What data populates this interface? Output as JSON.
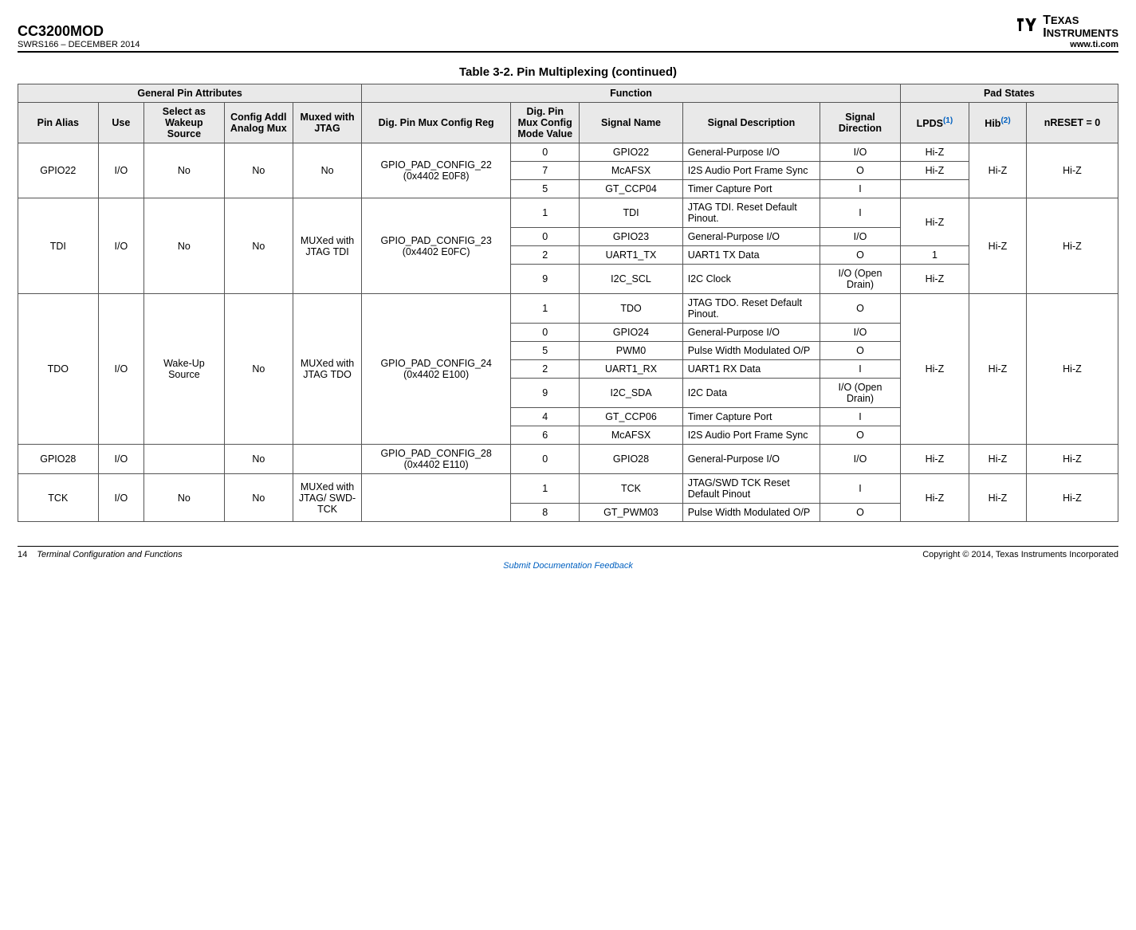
{
  "header": {
    "product": "CC3200MOD",
    "doc": "SWRS166 – DECEMBER 2014",
    "logo_text": "TEXAS INSTRUMENTS",
    "url": "www.ti.com"
  },
  "table": {
    "title": "Table 3-2. Pin Multiplexing (continued)",
    "group_headers": {
      "g1": "General Pin Attributes",
      "g2": "Function",
      "g3": "Pad States"
    },
    "col_headers": {
      "h1": "Pin Alias",
      "h2": "Use",
      "h3": "Select as Wakeup Source",
      "h4": "Config Addl Analog Mux",
      "h5": "Muxed with JTAG",
      "h6": "Dig. Pin Mux Config Reg",
      "h7": "Dig. Pin Mux Config Mode Value",
      "h8": "Signal Name",
      "h9": "Signal Description",
      "h10": "Signal Direction",
      "h11a": "LPDS",
      "h11ref": "(1)",
      "h12a": "Hib",
      "h12ref": "(2)",
      "h13": "nRESET = 0"
    },
    "rows": [
      {
        "alias": "GPIO22",
        "use": "I/O",
        "wakeup": "No",
        "analog": "No",
        "jtag": "No",
        "reg": "GPIO_PAD_CONFIG_22 (0x4402 E0F8)",
        "hib": "Hi-Z",
        "nreset": "Hi-Z",
        "funcs": [
          {
            "mode": "0",
            "name": "GPIO22",
            "desc": "General-Purpose I/O",
            "dir": "I/O",
            "lpds": "Hi-Z"
          },
          {
            "mode": "7",
            "name": "McAFSX",
            "desc": "I2S Audio Port Frame Sync",
            "dir": "O",
            "lpds": "Hi-Z"
          },
          {
            "mode": "5",
            "name": "GT_CCP04",
            "desc": "Timer Capture Port",
            "dir": "I",
            "lpds": ""
          }
        ]
      },
      {
        "alias": "TDI",
        "use": "I/O",
        "wakeup": "No",
        "analog": "No",
        "jtag": "MUXed with JTAG TDI",
        "reg": "GPIO_PAD_CONFIG_23 (0x4402 E0FC)",
        "hib": "Hi-Z",
        "nreset": "Hi-Z",
        "lpds_groups": [
          {
            "span": 2,
            "val": "Hi-Z"
          },
          {
            "span": 1,
            "val": "1"
          },
          {
            "span": 1,
            "val": "Hi-Z"
          }
        ],
        "funcs": [
          {
            "mode": "1",
            "name": "TDI",
            "desc": "JTAG TDI. Reset Default Pinout.",
            "dir": "I"
          },
          {
            "mode": "0",
            "name": "GPIO23",
            "desc": "General-Purpose I/O",
            "dir": "I/O"
          },
          {
            "mode": "2",
            "name": "UART1_TX",
            "desc": "UART1 TX Data",
            "dir": "O"
          },
          {
            "mode": "9",
            "name": "I2C_SCL",
            "desc": "I2C Clock",
            "dir": "I/O (Open Drain)"
          }
        ]
      },
      {
        "alias": "TDO",
        "use": "I/O",
        "wakeup": "Wake-Up Source",
        "analog": "No",
        "jtag": "MUXed with JTAG TDO",
        "reg": "GPIO_PAD_CONFIG_24 (0x4402 E100)",
        "lpds": "Hi-Z",
        "hib": "Hi-Z",
        "nreset": "Hi-Z",
        "funcs": [
          {
            "mode": "1",
            "name": "TDO",
            "desc": "JTAG TDO. Reset Default Pinout.",
            "dir": "O"
          },
          {
            "mode": "0",
            "name": "GPIO24",
            "desc": "General-Purpose I/O",
            "dir": "I/O"
          },
          {
            "mode": "5",
            "name": "PWM0",
            "desc": "Pulse Width Modulated O/P",
            "dir": "O"
          },
          {
            "mode": "2",
            "name": "UART1_RX",
            "desc": "UART1 RX Data",
            "dir": "I"
          },
          {
            "mode": "9",
            "name": "I2C_SDA",
            "desc": "I2C Data",
            "dir": "I/O (Open Drain)"
          },
          {
            "mode": "4",
            "name": "GT_CCP06",
            "desc": "Timer Capture Port",
            "dir": "I"
          },
          {
            "mode": "6",
            "name": "McAFSX",
            "desc": "I2S Audio Port Frame Sync",
            "dir": "O"
          }
        ]
      },
      {
        "alias": "GPIO28",
        "use": "I/O",
        "wakeup": "",
        "analog": "No",
        "jtag": "",
        "reg": "GPIO_PAD_CONFIG_28 (0x4402 E110)",
        "lpds": "Hi-Z",
        "hib": "Hi-Z",
        "nreset": "Hi-Z",
        "funcs": [
          {
            "mode": "0",
            "name": "GPIO28",
            "desc": "General-Purpose I/O",
            "dir": "I/O"
          }
        ]
      },
      {
        "alias": "TCK",
        "use": "I/O",
        "wakeup": "No",
        "analog": "No",
        "jtag": "MUXed with JTAG/ SWD-TCK",
        "reg": "",
        "lpds": "Hi-Z",
        "hib": "Hi-Z",
        "nreset": "Hi-Z",
        "funcs": [
          {
            "mode": "1",
            "name": "TCK",
            "desc": "JTAG/SWD TCK Reset Default Pinout",
            "dir": "I"
          },
          {
            "mode": "8",
            "name": "GT_PWM03",
            "desc": "Pulse Width Modulated O/P",
            "dir": "O"
          }
        ]
      }
    ]
  },
  "footer": {
    "page": "14",
    "section": "Terminal Configuration and Functions",
    "copyright": "Copyright © 2014, Texas Instruments Incorporated",
    "feedback": "Submit Documentation Feedback"
  }
}
